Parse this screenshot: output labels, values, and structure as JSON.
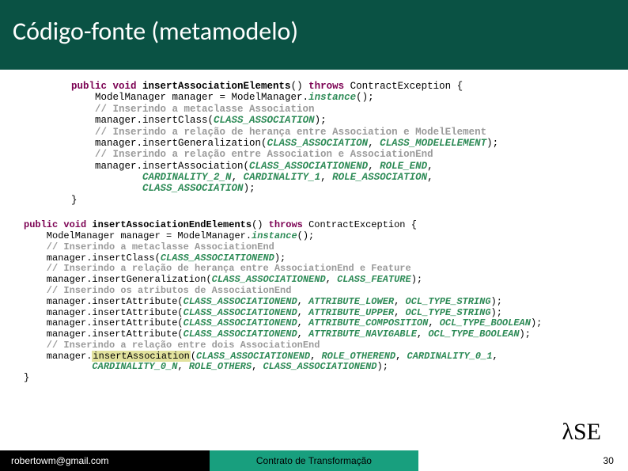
{
  "header": {
    "title": "Código-fonte (metamodelo)"
  },
  "code1": {
    "indent": "        ",
    "sig_pre": "public void ",
    "method": "insertAssociationElements",
    "sig_mid": "() ",
    "throws_kw": "throws",
    "sig_post": " ContractException {",
    "l2a": "            ModelManager manager = ModelManager.",
    "l2b": "instance",
    "l2c": "();",
    "c1": "            // Inserindo a metaclasse Association",
    "l3a": "            manager.insertClass(",
    "l3b": "CLASS_ASSOCIATION",
    "l3c": ");",
    "c2": "            // Inserindo a relação de herança entre Association e ModelElement",
    "l4a": "            manager.insertGeneralization(",
    "l4b": "CLASS_ASSOCIATION",
    "l4c": ", ",
    "l4d": "CLASS_MODELELEMENT",
    "l4e": ");",
    "c3": "            // Inserindo a relação entre Association e AssociationEnd",
    "l5a": "            manager.insertAssociation(",
    "l5b": "CLASS_ASSOCIATIONEND",
    "l5c": ", ",
    "l5d": "ROLE_END",
    "l5e": ",",
    "l6pad": "                    ",
    "l6a": "CARDINALITY_2_N",
    "l6b": ", ",
    "l6c": "CARDINALITY_1",
    "l6d": ", ",
    "l6e": "ROLE_ASSOCIATION",
    "l6f": ",",
    "l7a": "CLASS_ASSOCIATION",
    "l7b": ");",
    "close": "        }"
  },
  "code2": {
    "sig_pre": "public void ",
    "method": "insertAssociationEndElements",
    "sig_mid": "() ",
    "throws_kw": "throws",
    "sig_post": " ContractException {",
    "l2a": "    ModelManager manager = ModelManager.",
    "l2b": "instance",
    "l2c": "();",
    "c1": "    // Inserindo a metaclasse AssociationEnd",
    "l3a": "    manager.insertClass(",
    "l3b": "CLASS_ASSOCIATIONEND",
    "l3c": ");",
    "c2": "    // Inserindo a relação de herança entre AssociationEnd e Feature",
    "l4a": "    manager.insertGeneralization(",
    "l4b": "CLASS_ASSOCIATIONEND",
    "l4c": ", ",
    "l4d": "CLASS_FEATURE",
    "l4e": ");",
    "c3": "    // Inserindo os atributos de AssociationEnd",
    "a1a": "    manager.insertAttribute(",
    "a1b": "CLASS_ASSOCIATIONEND",
    "a1c": ", ",
    "a1d": "ATTRIBUTE_LOWER",
    "a1e": ", ",
    "a1f": "OCL_TYPE_STRING",
    "a1g": ");",
    "a2a": "    manager.insertAttribute(",
    "a2b": "CLASS_ASSOCIATIONEND",
    "a2c": ", ",
    "a2d": "ATTRIBUTE_UPPER",
    "a2e": ", ",
    "a2f": "OCL_TYPE_STRING",
    "a2g": ");",
    "a3a": "    manager.insertAttribute(",
    "a3b": "CLASS_ASSOCIATIONEND",
    "a3c": ", ",
    "a3d": "ATTRIBUTE_COMPOSITION",
    "a3e": ", ",
    "a3f": "OCL_TYPE_BOOLEAN",
    "a3g": ");",
    "a4a": "    manager.insertAttribute(",
    "a4b": "CLASS_ASSOCIATIONEND",
    "a4c": ", ",
    "a4d": "ATTRIBUTE_NAVIGABLE",
    "a4e": ", ",
    "a4f": "OCL_TYPE_BOOLEAN",
    "a4g": ");",
    "c4": "    // Inserindo a relação entre dois AssociationEnd",
    "l5a": "    manager.",
    "hl": "insertAssociation",
    "l5b": "(",
    "l5c": "CLASS_ASSOCIATIONEND",
    "l5d": ", ",
    "l5e": "ROLE_OTHEREND",
    "l5f": ", ",
    "l5g": "CARDINALITY_0_1",
    "l5h": ",",
    "l6pad": "            ",
    "l6a": "CARDINALITY_0_N",
    "l6b": ", ",
    "l6c": "ROLE_OTHERS",
    "l6d": ", ",
    "l6e": "CLASS_ASSOCIATIONEND",
    "l6f": ");",
    "close": "}"
  },
  "logo": {
    "lambda": "λ",
    "text": "SE"
  },
  "footer": {
    "left": "robertowm@gmail.com",
    "mid": "Contrato de Transformação",
    "right": "30"
  }
}
